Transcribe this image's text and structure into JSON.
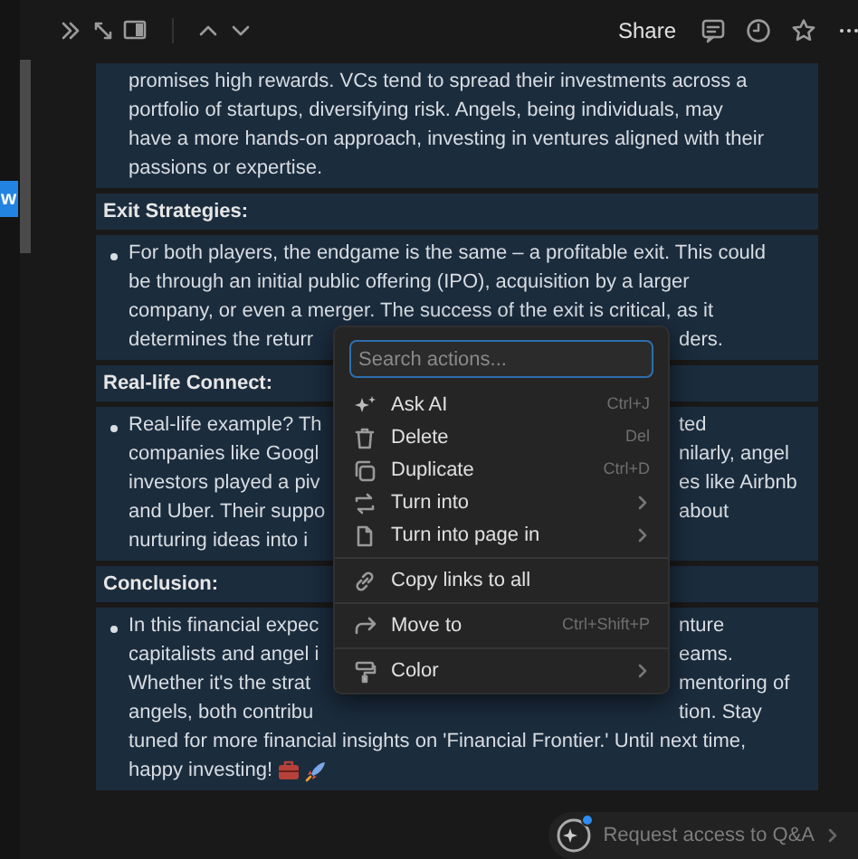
{
  "side_tab": {
    "label": "w"
  },
  "toolbar": {
    "share": "Share"
  },
  "blocks": [
    {
      "kind": "paragraph",
      "lines": [
        {
          "text": "promises high rewards. VCs tend to spread their investments across a"
        },
        {
          "text": "portfolio of startups, diversifying risk. Angels, being individuals, may"
        },
        {
          "text": "have a more hands-on approach, investing in ventures aligned with their"
        },
        {
          "text": "passions or expertise."
        }
      ]
    },
    {
      "kind": "heading",
      "text": "Exit Strategies:"
    },
    {
      "kind": "bullet",
      "lines": [
        {
          "text": "For both players, the endgame is the same – a profitable exit. This could"
        },
        {
          "text": "be through an initial public offering (IPO), acquisition by a larger"
        },
        {
          "text": "company, or even a merger. The success of the exit is critical, as it"
        },
        {
          "left": "determines the returr",
          "right": "ders."
        }
      ]
    },
    {
      "kind": "heading",
      "text": "Real-life Connect:"
    },
    {
      "kind": "bullet",
      "lines": [
        {
          "left": "Real-life example? Th",
          "right": "ted"
        },
        {
          "left": "companies like Googl",
          "right": "nilarly, angel"
        },
        {
          "left": "investors played a piv",
          "right": "es like Airbnb"
        },
        {
          "left": "and Uber. Their suppo",
          "right": "about"
        },
        {
          "left": "nurturing ideas into i"
        }
      ]
    },
    {
      "kind": "heading",
      "text": "Conclusion:"
    },
    {
      "kind": "bullet",
      "lines": [
        {
          "left": "In this financial expec",
          "right": "nture"
        },
        {
          "left": "capitalists and angel i",
          "right": "eams."
        },
        {
          "left": "Whether it's the strat",
          "right": "mentoring of"
        },
        {
          "left": "angels, both contribu",
          "right": "tion. Stay"
        },
        {
          "text": "tuned for more financial insights on 'Financial Frontier.' Until next time,"
        },
        {
          "text": "happy investing!",
          "trailing_icons": true
        }
      ]
    }
  ],
  "menu": {
    "search": {
      "placeholder": "Search actions...",
      "focused": true
    },
    "items": [
      {
        "label": "Ask AI",
        "shortcut": "Ctrl+J",
        "submenu": false,
        "divider_before": false
      },
      {
        "label": "Delete",
        "shortcut": "Del",
        "submenu": false,
        "divider_before": false
      },
      {
        "label": "Duplicate",
        "shortcut": "Ctrl+D",
        "submenu": false,
        "divider_before": false
      },
      {
        "label": "Turn into",
        "submenu": true,
        "divider_before": false
      },
      {
        "label": "Turn into page in",
        "submenu": true,
        "divider_before": false
      },
      {
        "label": "Copy links to all",
        "submenu": false,
        "divider_before": true
      },
      {
        "label": "Move to",
        "shortcut": "Ctrl+Shift+P",
        "submenu": false,
        "divider_before": true
      },
      {
        "label": "Color",
        "submenu": true,
        "divider_before": true
      }
    ]
  },
  "qa_button": {
    "label": "Request access to Q&A",
    "notification": true
  }
}
